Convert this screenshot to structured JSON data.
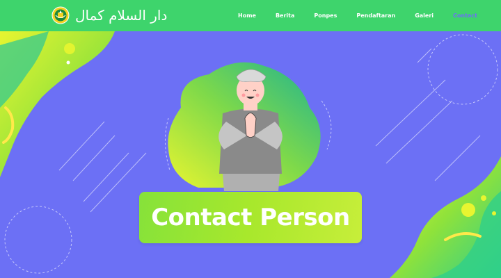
{
  "brand": {
    "logo_text": "دار السلام كمال",
    "emblem_icon": "school-emblem-icon"
  },
  "nav": {
    "items": [
      {
        "label": "Home",
        "active": false
      },
      {
        "label": "Berita",
        "active": false
      },
      {
        "label": "Ponpes",
        "active": false
      },
      {
        "label": "Pendaftaran",
        "active": false
      },
      {
        "label": "Galeri",
        "active": false
      },
      {
        "label": "Contact",
        "active": true
      }
    ]
  },
  "hero": {
    "cta_label": "Contact Person",
    "illustration": "greeting-man-illustration"
  },
  "colors": {
    "navbar": "#3ed46c",
    "background": "#6c70f5",
    "accent_yellow": "#e8f530",
    "accent_green": "#2fcf8a",
    "active_nav": "#6c70f5"
  }
}
